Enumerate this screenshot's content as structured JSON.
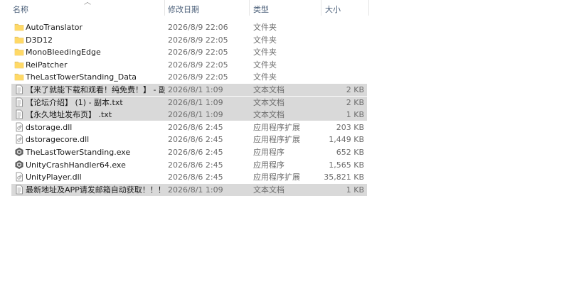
{
  "columns": {
    "name": "名称",
    "date": "修改日期",
    "type": "类型",
    "size": "大小"
  },
  "files": [
    {
      "name": "AutoTranslator",
      "date": "2026/8/9 22:06",
      "type": "文件夹",
      "size": "",
      "icon": "folder-icon",
      "selected": false
    },
    {
      "name": "D3D12",
      "date": "2026/8/9 22:05",
      "type": "文件夹",
      "size": "",
      "icon": "folder-icon",
      "selected": false
    },
    {
      "name": "MonoBleedingEdge",
      "date": "2026/8/9 22:05",
      "type": "文件夹",
      "size": "",
      "icon": "folder-icon",
      "selected": false
    },
    {
      "name": "ReiPatcher",
      "date": "2026/8/9 22:05",
      "type": "文件夹",
      "size": "",
      "icon": "folder-icon",
      "selected": false
    },
    {
      "name": "TheLastTowerStanding_Data",
      "date": "2026/8/9 22:05",
      "type": "文件夹",
      "size": "",
      "icon": "folder-icon",
      "selected": false
    },
    {
      "name": "【来了就能下载和观看！纯免费！】 - 副...",
      "date": "2026/8/1 1:09",
      "type": "文本文档",
      "size": "2 KB",
      "icon": "text-file-icon",
      "selected": true
    },
    {
      "name": "【论坛介绍】 (1) - 副本.txt",
      "date": "2026/8/1 1:09",
      "type": "文本文档",
      "size": "2 KB",
      "icon": "text-file-icon",
      "selected": true
    },
    {
      "name": "【永久地址发布页】 .txt",
      "date": "2026/8/1 1:09",
      "type": "文本文档",
      "size": "1 KB",
      "icon": "text-file-icon",
      "selected": true
    },
    {
      "name": "dstorage.dll",
      "date": "2026/8/6 2:45",
      "type": "应用程序扩展",
      "size": "203 KB",
      "icon": "dll-file-icon",
      "selected": false
    },
    {
      "name": "dstoragecore.dll",
      "date": "2026/8/6 2:45",
      "type": "应用程序扩展",
      "size": "1,449 KB",
      "icon": "dll-file-icon",
      "selected": false
    },
    {
      "name": "TheLastTowerStanding.exe",
      "date": "2026/8/6 2:45",
      "type": "应用程序",
      "size": "652 KB",
      "icon": "unity-exe-icon",
      "selected": false
    },
    {
      "name": "UnityCrashHandler64.exe",
      "date": "2026/8/6 2:45",
      "type": "应用程序",
      "size": "1,565 KB",
      "icon": "unity-exe-icon",
      "selected": false
    },
    {
      "name": "UnityPlayer.dll",
      "date": "2026/8/6 2:45",
      "type": "应用程序扩展",
      "size": "35,821 KB",
      "icon": "dll-file-icon",
      "selected": false
    },
    {
      "name": "最新地址及APP请发邮箱自动获取！！！...",
      "date": "2026/8/1 1:09",
      "type": "文本文档",
      "size": "1 KB",
      "icon": "text-file-icon",
      "selected": true
    }
  ]
}
